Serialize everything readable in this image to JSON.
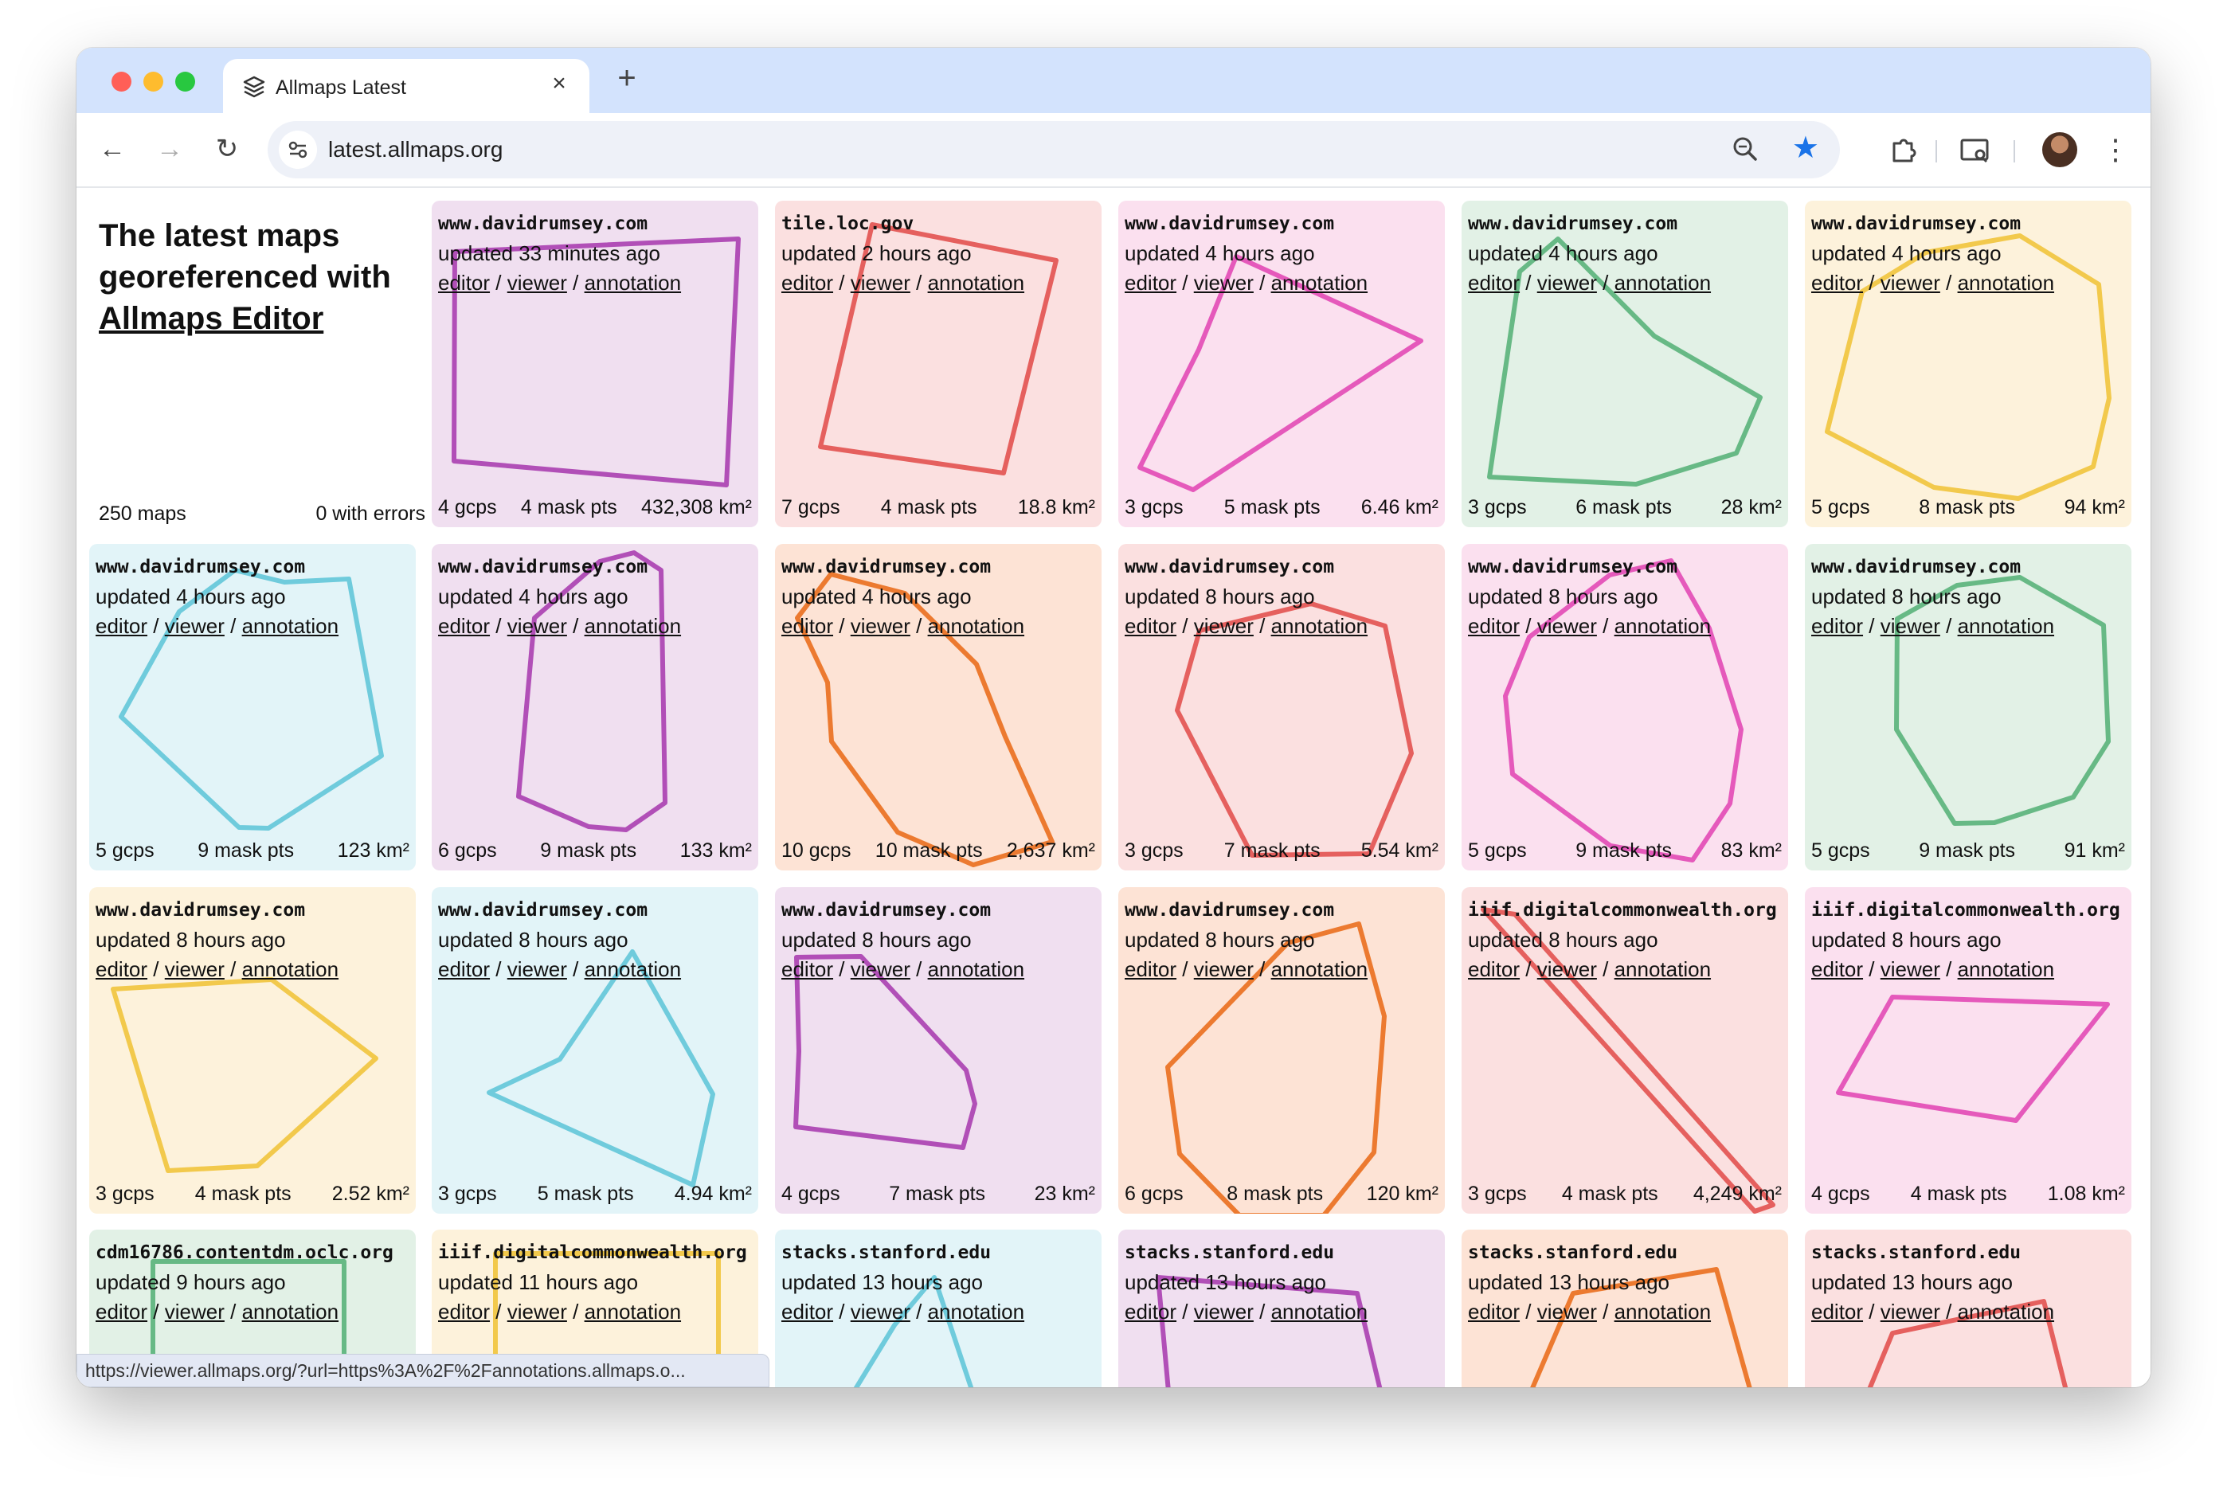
{
  "browser": {
    "tab_title": "Allmaps Latest",
    "tab_close": "×",
    "new_tab": "+",
    "url": "latest.allmaps.org",
    "status_url": "https://viewer.allmaps.org/?url=https%3A%2F%2Fannotations.allmaps.o..."
  },
  "intro": {
    "heading_line1": "The latest maps",
    "heading_line2": "georeferenced with",
    "heading_link": "Allmaps Editor",
    "maps_count": "250 maps",
    "errors_count": "0 with errors"
  },
  "links": {
    "editor": "editor",
    "viewer": "viewer",
    "annotation": "annotation",
    "sep": "/"
  },
  "colors": {
    "purple": "#b14fb7",
    "red": "#e5605e",
    "pink": "#e559bb",
    "green": "#67b985",
    "yellow": "#f2c94c",
    "cyan": "#6fcbdc",
    "orange": "#ec7a30"
  },
  "cards": [
    {
      "host": "www.davidrumsey.com",
      "updated": "updated 33 minutes ago",
      "gcps": "4 gcps",
      "mask": "4 mask pts",
      "area": "432,308 km²",
      "color": "purple"
    },
    {
      "host": "tile.loc.gov",
      "updated": "updated 2 hours ago",
      "gcps": "7 gcps",
      "mask": "4 mask pts",
      "area": "18.8 km²",
      "color": "red"
    },
    {
      "host": "www.davidrumsey.com",
      "updated": "updated 4 hours ago",
      "gcps": "3 gcps",
      "mask": "5 mask pts",
      "area": "6.46 km²",
      "color": "pink"
    },
    {
      "host": "www.davidrumsey.com",
      "updated": "updated 4 hours ago",
      "gcps": "3 gcps",
      "mask": "6 mask pts",
      "area": "28 km²",
      "color": "green"
    },
    {
      "host": "www.davidrumsey.com",
      "updated": "updated 4 hours ago",
      "gcps": "5 gcps",
      "mask": "8 mask pts",
      "area": "94 km²",
      "color": "yellow"
    },
    {
      "host": "www.davidrumsey.com",
      "updated": "updated 4 hours ago",
      "gcps": "5 gcps",
      "mask": "9 mask pts",
      "area": "123 km²",
      "color": "cyan"
    },
    {
      "host": "www.davidrumsey.com",
      "updated": "updated 4 hours ago",
      "gcps": "6 gcps",
      "mask": "9 mask pts",
      "area": "133 km²",
      "color": "purple"
    },
    {
      "host": "www.davidrumsey.com",
      "updated": "updated 4 hours ago",
      "gcps": "10 gcps",
      "mask": "10 mask pts",
      "area": "2,637 km²",
      "color": "orange"
    },
    {
      "host": "www.davidrumsey.com",
      "updated": "updated 8 hours ago",
      "gcps": "3 gcps",
      "mask": "7 mask pts",
      "area": "5.54 km²",
      "color": "red"
    },
    {
      "host": "www.davidrumsey.com",
      "updated": "updated 8 hours ago",
      "gcps": "5 gcps",
      "mask": "9 mask pts",
      "area": "83 km²",
      "color": "pink"
    },
    {
      "host": "www.davidrumsey.com",
      "updated": "updated 8 hours ago",
      "gcps": "5 gcps",
      "mask": "9 mask pts",
      "area": "91 km²",
      "color": "green"
    },
    {
      "host": "www.davidrumsey.com",
      "updated": "updated 8 hours ago",
      "gcps": "3 gcps",
      "mask": "4 mask pts",
      "area": "2.52 km²",
      "color": "yellow"
    },
    {
      "host": "www.davidrumsey.com",
      "updated": "updated 8 hours ago",
      "gcps": "3 gcps",
      "mask": "5 mask pts",
      "area": "4.94 km²",
      "color": "cyan"
    },
    {
      "host": "www.davidrumsey.com",
      "updated": "updated 8 hours ago",
      "gcps": "4 gcps",
      "mask": "7 mask pts",
      "area": "23 km²",
      "color": "purple"
    },
    {
      "host": "www.davidrumsey.com",
      "updated": "updated 8 hours ago",
      "gcps": "6 gcps",
      "mask": "8 mask pts",
      "area": "120 km²",
      "color": "orange"
    },
    {
      "host": "iiif.digitalcommonwealth.org",
      "updated": "updated 8 hours ago",
      "gcps": "3 gcps",
      "mask": "4 mask pts",
      "area": "4,249 km²",
      "color": "red"
    },
    {
      "host": "iiif.digitalcommonwealth.org",
      "updated": "updated 8 hours ago",
      "gcps": "4 gcps",
      "mask": "4 mask pts",
      "area": "1.08 km²",
      "color": "pink"
    },
    {
      "host": "cdm16786.contentdm.oclc.org",
      "updated": "updated 9 hours ago",
      "gcps": "",
      "mask": "",
      "area": "",
      "color": "green"
    },
    {
      "host": "iiif.digitalcommonwealth.org",
      "updated": "updated 11 hours ago",
      "gcps": "",
      "mask": "",
      "area": "",
      "color": "yellow"
    },
    {
      "host": "stacks.stanford.edu",
      "updated": "updated 13 hours ago",
      "gcps": "",
      "mask": "",
      "area": "",
      "color": "cyan"
    },
    {
      "host": "stacks.stanford.edu",
      "updated": "updated 13 hours ago",
      "gcps": "",
      "mask": "",
      "area": "",
      "color": "purple"
    },
    {
      "host": "stacks.stanford.edu",
      "updated": "updated 13 hours ago",
      "gcps": "",
      "mask": "",
      "area": "",
      "color": "orange"
    },
    {
      "host": "stacks.stanford.edu",
      "updated": "updated 13 hours ago",
      "gcps": "",
      "mask": "",
      "area": "",
      "color": "red"
    }
  ]
}
